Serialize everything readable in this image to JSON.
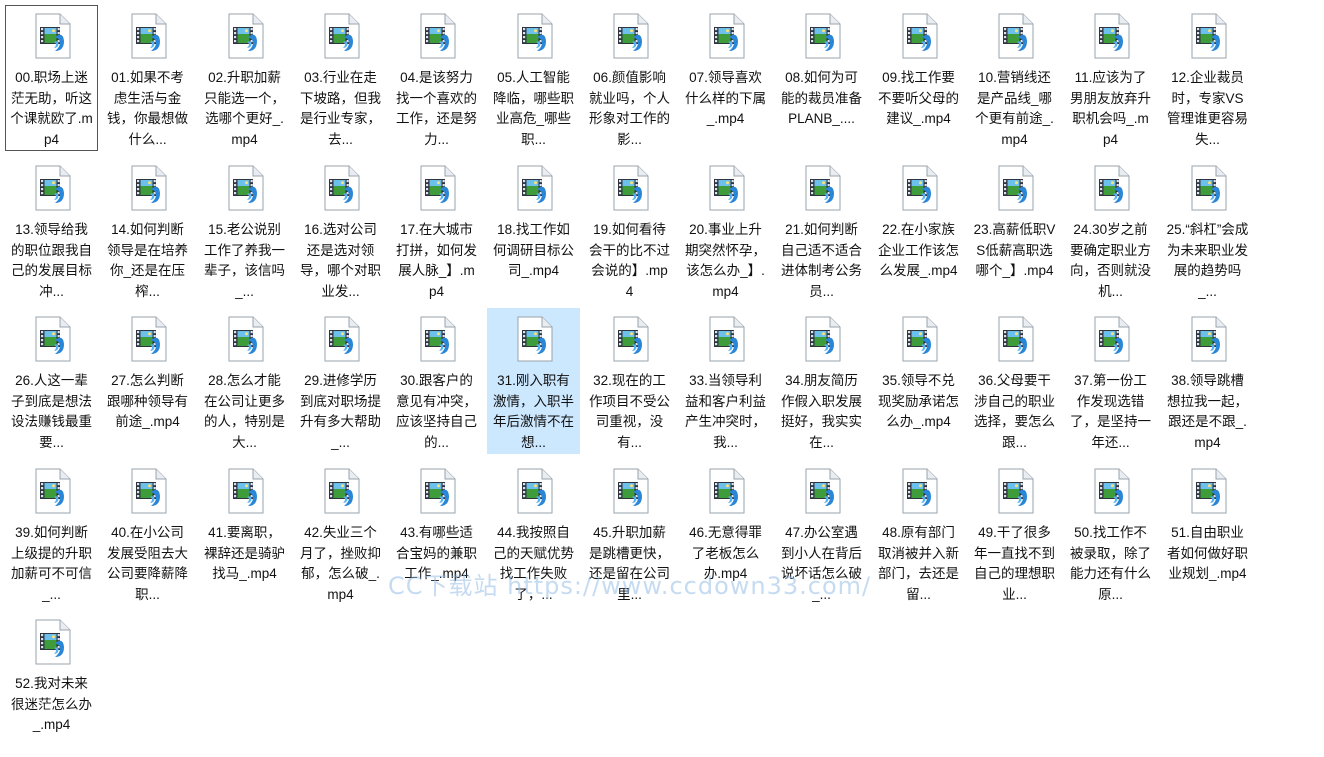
{
  "view": "large-icons",
  "icon": "video-audio-file-icon",
  "files": [
    {
      "name": "00.职场上迷茫无助，听这个课就欧了.mp4",
      "state": "focused"
    },
    {
      "name": "01.如果不考虑生活与金钱，你最想做什么...",
      "state": "normal"
    },
    {
      "name": "02.升职加薪只能选一个，选哪个更好_.mp4",
      "state": "normal"
    },
    {
      "name": "03.行业在走下坡路，但我是行业专家，去...",
      "state": "normal"
    },
    {
      "name": "04.是该努力找一个喜欢的工作，还是努力...",
      "state": "normal"
    },
    {
      "name": "05.人工智能降临，哪些职业高危_哪些职...",
      "state": "normal"
    },
    {
      "name": "06.颜值影响就业吗，个人形象对工作的影...",
      "state": "normal"
    },
    {
      "name": "07.领导喜欢什么样的下属_.mp4",
      "state": "normal"
    },
    {
      "name": "08.如何为可能的裁员准备PLANB_....",
      "state": "normal"
    },
    {
      "name": "09.找工作要不要听父母的建议_.mp4",
      "state": "normal"
    },
    {
      "name": "10.营销线还是产品线_哪个更有前途_.mp4",
      "state": "normal"
    },
    {
      "name": "11.应该为了男朋友放弃升职机会吗_.mp4",
      "state": "normal"
    },
    {
      "name": "12.企业裁员时，专家VS管理谁更容易失...",
      "state": "normal"
    },
    {
      "name": "13.领导给我的职位跟我自己的发展目标冲...",
      "state": "normal"
    },
    {
      "name": "14.如何判断领导是在培养你_还是在压榨...",
      "state": "normal"
    },
    {
      "name": "15.老公说别工作了养我一辈子，该信吗_...",
      "state": "normal"
    },
    {
      "name": "16.选对公司还是选对领导，哪个对职业发...",
      "state": "normal"
    },
    {
      "name": "17.在大城市打拼，如何发展人脉_】.mp4",
      "state": "normal"
    },
    {
      "name": "18.找工作如何调研目标公司_.mp4",
      "state": "normal"
    },
    {
      "name": "19.如何看待会干的比不过会说的】.mp4",
      "state": "normal"
    },
    {
      "name": "20.事业上升期突然怀孕，该怎么办_】.mp4",
      "state": "normal"
    },
    {
      "name": "21.如何判断自己适不适合进体制考公务员...",
      "state": "normal"
    },
    {
      "name": "22.在小家族企业工作该怎么发展_.mp4",
      "state": "normal"
    },
    {
      "name": "23.高薪低职VS低薪高职选哪个_】.mp4",
      "state": "normal"
    },
    {
      "name": "24.30岁之前要确定职业方向，否则就没机...",
      "state": "normal"
    },
    {
      "name": "25.“斜杠”会成为未来职业发展的趋势吗_...",
      "state": "normal"
    },
    {
      "name": "26.人这一辈子到底是想法设法赚钱最重要...",
      "state": "normal"
    },
    {
      "name": "27.怎么判断跟哪种领导有前途_.mp4",
      "state": "normal"
    },
    {
      "name": "28.怎么才能在公司让更多的人，特别是大...",
      "state": "normal"
    },
    {
      "name": "29.进修学历到底对职场提升有多大帮助_...",
      "state": "normal"
    },
    {
      "name": "30.跟客户的意见有冲突，应该坚持自己的...",
      "state": "normal"
    },
    {
      "name": "31.刚入职有激情，入职半年后激情不在想...",
      "state": "selected"
    },
    {
      "name": "32.现在的工作项目不受公司重视，没有...",
      "state": "normal"
    },
    {
      "name": "33.当领导利益和客户利益产生冲突时，我...",
      "state": "normal"
    },
    {
      "name": "34.朋友简历作假入职发展挺好，我实实在...",
      "state": "normal"
    },
    {
      "name": "35.领导不兑现奖励承诺怎么办_.mp4",
      "state": "normal"
    },
    {
      "name": "36.父母要干涉自己的职业选择，要怎么跟...",
      "state": "normal"
    },
    {
      "name": "37.第一份工作发现选错了，是坚持一年还...",
      "state": "normal"
    },
    {
      "name": "38.领导跳槽想拉我一起，跟还是不跟_.mp4",
      "state": "normal"
    },
    {
      "name": "39.如何判断上级提的升职加薪可不可信_...",
      "state": "normal"
    },
    {
      "name": "40.在小公司发展受阻去大公司要降薪降职...",
      "state": "normal"
    },
    {
      "name": "41.要离职，裸辞还是骑驴找马_.mp4",
      "state": "normal"
    },
    {
      "name": "42.失业三个月了，挫败抑郁，怎么破_.mp4",
      "state": "normal"
    },
    {
      "name": "43.有哪些适合宝妈的兼职工作_.mp4",
      "state": "normal"
    },
    {
      "name": "44.我按照自己的天赋优势找工作失败了，...",
      "state": "normal"
    },
    {
      "name": "45.升职加薪是跳槽更快，还是留在公司里...",
      "state": "normal"
    },
    {
      "name": "46.无意得罪了老板怎么办.mp4",
      "state": "normal"
    },
    {
      "name": "47.办公室遇到小人在背后说坏话怎么破_...",
      "state": "normal"
    },
    {
      "name": "48.原有部门取消被并入新部门，去还是留...",
      "state": "normal"
    },
    {
      "name": "49.干了很多年一直找不到自己的理想职业...",
      "state": "normal"
    },
    {
      "name": "50.找工作不被录取，除了能力还有什么原...",
      "state": "normal"
    },
    {
      "name": "51.自由职业者如何做好职业规划_.mp4",
      "state": "normal"
    },
    {
      "name": "52.我对未来很迷茫怎么办_.mp4",
      "state": "normal"
    }
  ],
  "watermark": "CC下载站 https://www.ccdown33.com/"
}
